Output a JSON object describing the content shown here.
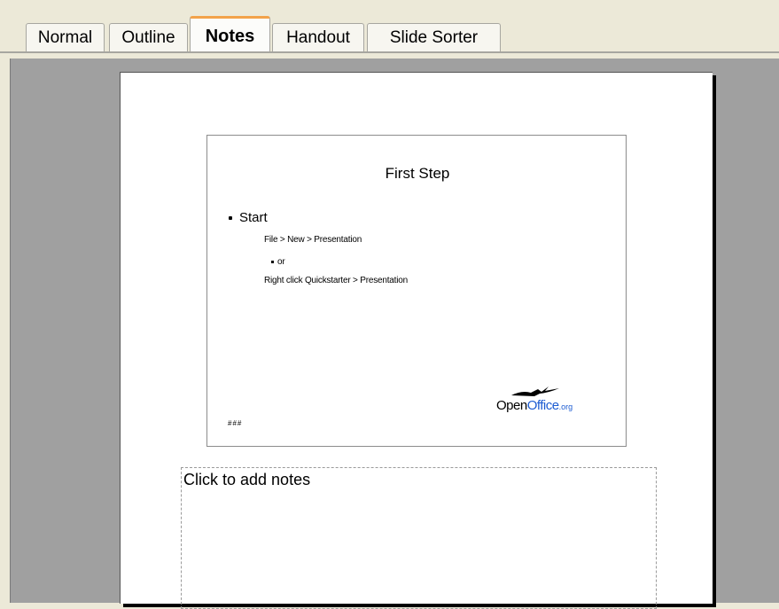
{
  "tabs": [
    {
      "label": "Normal",
      "active": false
    },
    {
      "label": "Outline",
      "active": false
    },
    {
      "label": "Notes",
      "active": true
    },
    {
      "label": "Handout",
      "active": false
    },
    {
      "label": "Slide Sorter",
      "active": false
    }
  ],
  "slide": {
    "title": "First Step",
    "bullet": "Start",
    "sub_items": [
      "File > New > Presentation",
      "or",
      "Right click Quickstarter > Presentation"
    ],
    "footer_text": "###",
    "logo": {
      "open": "Open",
      "office": "Office",
      "org": ".org"
    }
  },
  "notes": {
    "placeholder": "Click to add notes"
  },
  "colors": {
    "active_tab_accent": "#f2a24a",
    "workspace": "#a0a0a0",
    "logo_blue": "#1d5cd2"
  }
}
